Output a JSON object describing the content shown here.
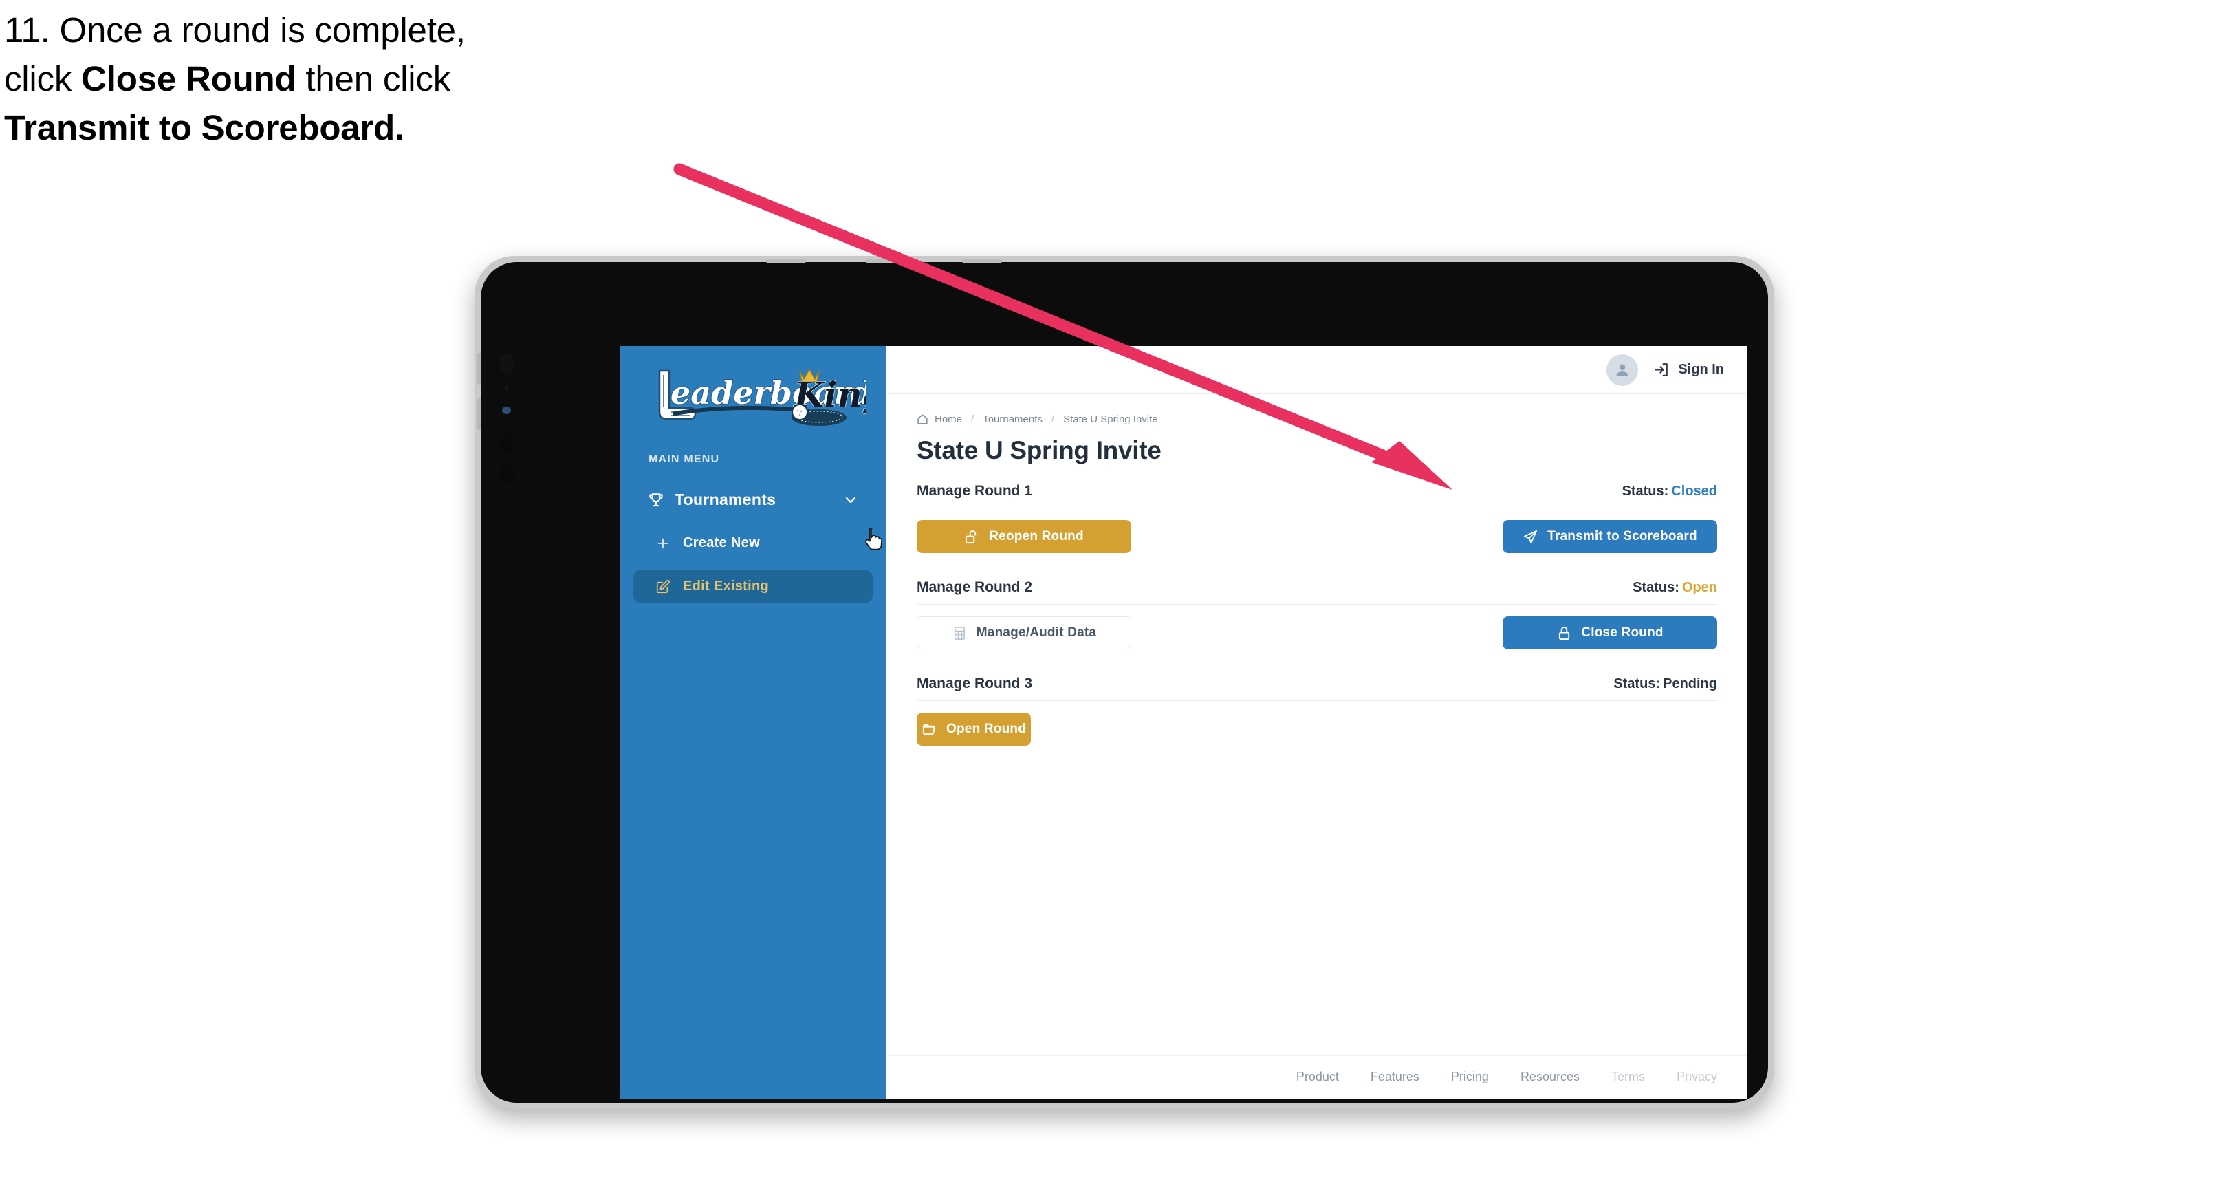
{
  "instruction": {
    "line1": "11. Once a round is complete,",
    "line2_pre": "click ",
    "line2_bold": "Close Round",
    "line2_post": " then click",
    "line3_bold": "Transmit to Scoreboard."
  },
  "colors": {
    "sidebar_blue": "#2b7cba",
    "sidebar_active": "#1f6699",
    "sidebar_active_text": "#e6c36a",
    "gold": "#d4a032",
    "blue": "#2c7bbf",
    "status_closed": "#2f80c4",
    "status_open": "#e0a32e",
    "arrow": "#e8315f",
    "crown_gold": "#e8b93a"
  },
  "sidebar": {
    "logo_primary": "Leaderboard",
    "logo_secondary": "King",
    "logo_icons": [
      "golf-club-icon",
      "crown-icon",
      "golf-ball-icon"
    ],
    "menu_label": "MAIN MENU",
    "nav": {
      "icon": "trophy-icon",
      "label": "Tournaments",
      "chevron": "chevron-down-icon"
    },
    "items": [
      {
        "label": "Create New",
        "icon": "plus-icon",
        "active": false
      },
      {
        "label": "Edit Existing",
        "icon": "edit-square-icon",
        "active": true
      }
    ],
    "cursor": "pointer-hand-cursor"
  },
  "topbar": {
    "avatar_icon": "user-avatar-icon",
    "signin_icon": "sign-in-arrow-icon",
    "signin_label": "Sign In"
  },
  "breadcrumb": {
    "home_icon": "home-icon",
    "items": [
      "Home",
      "Tournaments",
      "State U Spring Invite"
    ],
    "separator": "/"
  },
  "page": {
    "title": "State U Spring Invite"
  },
  "rounds": [
    {
      "name": "Manage Round 1",
      "status_label": "Status:",
      "status_value": "Closed",
      "status_class": "st-closed",
      "left_button": {
        "label": "Reopen Round",
        "icon": "unlock-icon",
        "style": "btn-gold"
      },
      "right_button": {
        "label": "Transmit to Scoreboard",
        "icon": "paper-plane-icon",
        "style": "btn-blue"
      }
    },
    {
      "name": "Manage Round 2",
      "status_label": "Status:",
      "status_value": "Open",
      "status_class": "st-open",
      "left_button": {
        "label": "Manage/Audit Data",
        "icon": "table-grid-icon",
        "style": "btn-ghost"
      },
      "right_button": {
        "label": "Close Round",
        "icon": "lock-icon",
        "style": "btn-blue"
      }
    },
    {
      "name": "Manage Round 3",
      "status_label": "Status:",
      "status_value": "Pending",
      "status_class": "st-pending",
      "left_button": {
        "label": "Open Round",
        "icon": "folder-open-icon",
        "style": "btn-gold-sm"
      },
      "right_button": null
    }
  ],
  "footer": {
    "links": [
      {
        "label": "Product",
        "dim": false
      },
      {
        "label": "Features",
        "dim": false
      },
      {
        "label": "Pricing",
        "dim": false
      },
      {
        "label": "Resources",
        "dim": false
      },
      {
        "label": "Terms",
        "dim": true
      },
      {
        "label": "Privacy",
        "dim": true
      }
    ]
  },
  "annotation": {
    "type": "arrow",
    "points_to": "Transmit to Scoreboard button"
  }
}
